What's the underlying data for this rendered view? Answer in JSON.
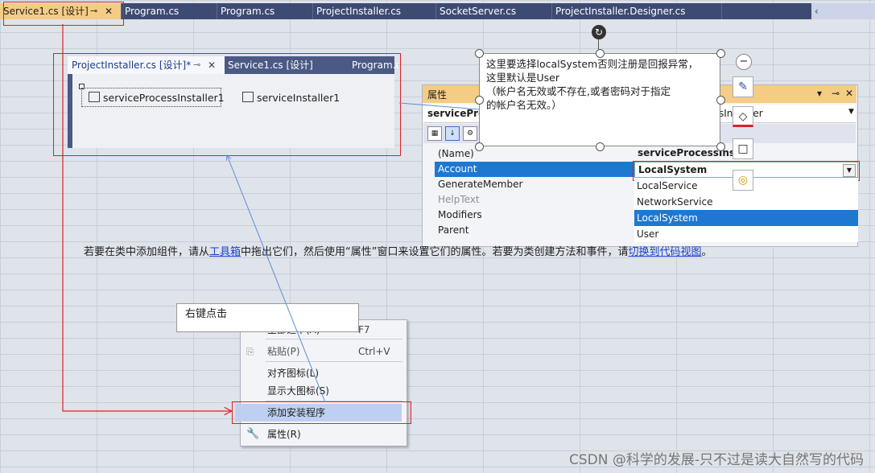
{
  "top_tabs": [
    {
      "label": "Service1.cs [设计]",
      "active": true
    },
    {
      "label": "Program.cs"
    },
    {
      "label": "Program.cs"
    },
    {
      "label": "ProjectInstaller.cs"
    },
    {
      "label": "SocketServer.cs"
    },
    {
      "label": "ProjectInstaller.Designer.cs"
    }
  ],
  "tab_icons": {
    "pin": "⊸",
    "close": "✕",
    "overflow": "‹"
  },
  "designer": {
    "tabs": [
      {
        "label": "ProjectInstaller.cs [设计]*",
        "active": true
      },
      {
        "label": "Service1.cs [设计]"
      },
      {
        "label": "Program.cs"
      }
    ],
    "components": [
      "serviceProcessInstaller1",
      "serviceInstaller1"
    ]
  },
  "properties": {
    "title": "属性",
    "title_buttons": [
      "▾",
      "⊸",
      "✕"
    ],
    "object": "servicePro",
    "object_suffix": "sInstaller",
    "rows": [
      {
        "name": "(Name)",
        "value": "serviceProcessInsta"
      },
      {
        "name": "Account",
        "value": "LocalSystem",
        "selected": true
      },
      {
        "name": "GenerateMember"
      },
      {
        "name": "HelpText",
        "disabled": true
      },
      {
        "name": "Modifiers"
      },
      {
        "name": "Parent"
      }
    ],
    "dropdown": {
      "current": "LocalSystem",
      "options": [
        "LocalService",
        "NetworkService",
        "LocalSystem",
        "User"
      ],
      "selected": "LocalSystem"
    }
  },
  "callout": {
    "lines": [
      "这里要选择localSystem否则注册是回报异常，",
      "这里默认是User",
      "（帐户名无效或不存在,或者密码对于指定",
      "的帐户名无效。）"
    ],
    "tools": [
      "minus-icon",
      "pen-icon",
      "fill-icon",
      "square-icon",
      "bulb-icon"
    ]
  },
  "hint": {
    "prefix": "若要在类中添加组件，请从",
    "link1": "工具箱",
    "middle": "中拖出它们，然后使用“属性”窗口来设置它们的属性。若要为类创建方法和事件，请",
    "link2": "切换到代码视图",
    "suffix": "。"
  },
  "right_click_label": "右键点击",
  "context_menu": [
    {
      "label": "全部选中(A)",
      "shortcut": "F7"
    },
    {
      "label": "粘贴(P)",
      "shortcut": "Ctrl+V",
      "icon": "paste-icon",
      "disabled": true
    },
    {
      "label": "对齐图标(L)"
    },
    {
      "label": "显示大图标(S)"
    },
    {
      "label": "添加安装程序",
      "highlighted": true
    },
    {
      "label": "属性(R)",
      "icon": "wrench-icon"
    }
  ],
  "watermark": "CSDN @科学的发展-只不过是读大自然写的代码",
  "colors": {
    "accent_tab": "#f5cc84",
    "tab_bg": "#3d4b73",
    "annotation_red": "#d8232a",
    "arrow_blue": "#5b8fd9",
    "selection": "#1e78d2"
  }
}
